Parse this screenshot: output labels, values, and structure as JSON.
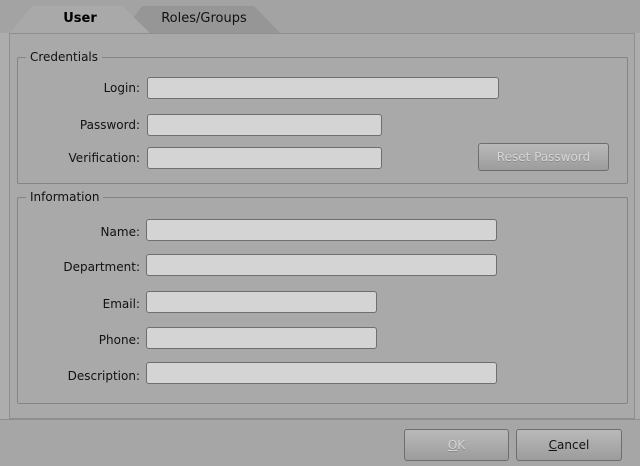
{
  "tabs": [
    {
      "label": "User",
      "active": true
    },
    {
      "label": "Roles/Groups",
      "active": false
    }
  ],
  "credentials": {
    "legend": "Credentials",
    "login_label": "Login:",
    "login_value": "",
    "password_label": "Password:",
    "password_value": "",
    "verification_label": "Verification:",
    "verification_value": "",
    "reset_button": "Reset Password"
  },
  "information": {
    "legend": "Information",
    "name_label": "Name:",
    "name_value": "",
    "department_label": "Department:",
    "department_value": "",
    "email_label": "Email:",
    "email_value": "",
    "phone_label": "Phone:",
    "phone_value": "",
    "description_label": "Description:",
    "description_value": ""
  },
  "footer": {
    "ok_mnemonic": "O",
    "ok_rest": "K",
    "cancel_mnemonic": "C",
    "cancel_rest": "ancel"
  },
  "colors": {
    "background": "#adadad",
    "field_bg": "#d4d4d4",
    "disabled_text": "#d6d6d6"
  }
}
